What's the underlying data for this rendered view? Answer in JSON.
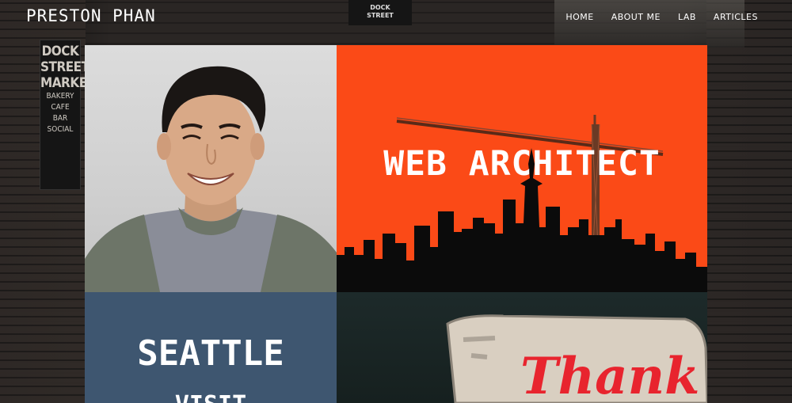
{
  "header": {
    "logo": "PRESTON PHAN",
    "nav": [
      {
        "label": "HOME"
      },
      {
        "label": "ABOUT ME"
      },
      {
        "label": "LAB"
      },
      {
        "label": "ARTICLES"
      }
    ]
  },
  "background": {
    "sign_big": [
      "DOCK",
      "STREET",
      "MARKET"
    ],
    "sign_small": [
      "BAKERY",
      "CAFE",
      "BAR",
      "SOCIAL"
    ],
    "box_text": [
      "DOCK",
      "STREET"
    ]
  },
  "tiles": {
    "architect": {
      "title": "WEB ARCHITECT",
      "color": "#fb4a17"
    },
    "seattle": {
      "title": "SEATTLE",
      "subtitle": "VISIT",
      "color": "#3e5670"
    },
    "neon": {
      "sign_text": "Thank"
    }
  },
  "colors": {
    "header_text": "#ffffff",
    "orange": "#fb4a17",
    "slate": "#3e5670"
  }
}
